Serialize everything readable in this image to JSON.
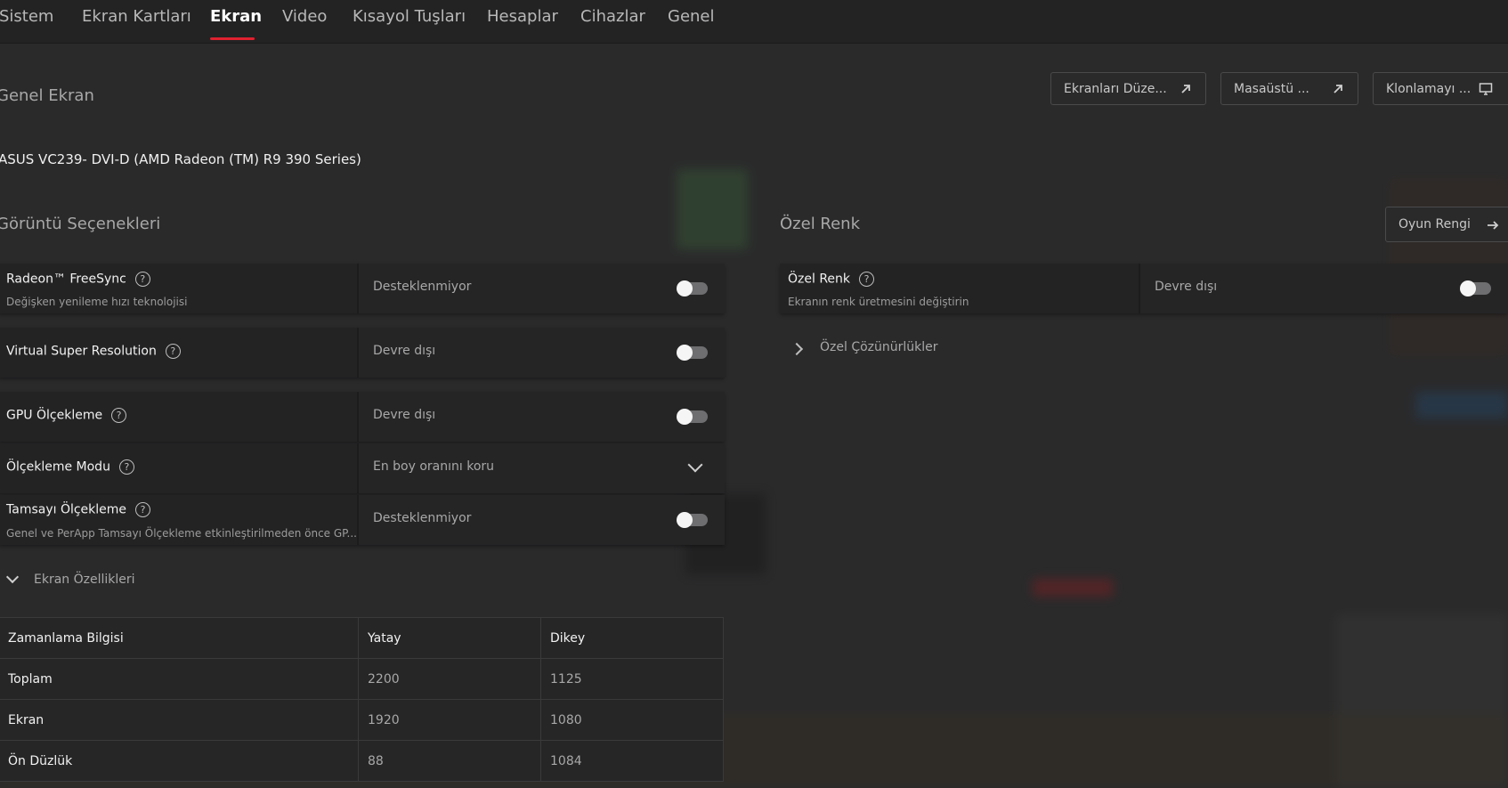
{
  "nav": {
    "tabs": [
      "Sistem",
      "Ekran Kartları",
      "Ekran",
      "Video",
      "Kısayol Tuşları",
      "Hesaplar",
      "Cihazlar",
      "Genel"
    ],
    "active_tab": "Ekran"
  },
  "general": {
    "title": "Genel Ekran",
    "device": "ASUS VC239- DVI-D (AMD Radeon (TM) R9 390 Series)"
  },
  "header_buttons": {
    "arrange_label": "Ekranları Düze...",
    "desktop_label": "Masaüstü ...",
    "clone_label": "Klonlamayı ..."
  },
  "display_options": {
    "title": "Görüntü Seçenekleri",
    "freesync": {
      "title": "Radeon™ FreeSync",
      "subtitle": "Değişken yenileme hızı teknolojisi",
      "value": "Desteklenmiyor",
      "enabled": false
    },
    "vsr": {
      "title": "Virtual Super Resolution",
      "value": "Devre dışı",
      "enabled": false
    },
    "gpu_scaling": {
      "title": "GPU Ölçekleme",
      "value": "Devre dışı",
      "enabled": false
    },
    "scaling_mode": {
      "title": "Ölçekleme Modu",
      "value": "En boy oranını koru"
    },
    "integer_scaling": {
      "title": "Tamsayı Ölçekleme",
      "subtitle": "Genel ve PerApp Tamsayı Ölçekleme etkinleştirilmeden önce GP...",
      "value": "Desteklenmiyor",
      "enabled": false
    }
  },
  "custom_color": {
    "title": "Özel Renk",
    "game_color_button": "Oyun Rengi",
    "row": {
      "title": "Özel Renk",
      "subtitle": "Ekranın renk üretmesini değiştirin",
      "value": "Devre dışı",
      "enabled": false
    },
    "custom_resolutions": "Özel Çözünürlükler"
  },
  "display_specs": {
    "label": "Ekran Özellikleri",
    "headers": [
      "Zamanlama Bilgisi",
      "Yatay",
      "Dikey"
    ],
    "rows": [
      [
        "Toplam",
        "2200",
        "1125"
      ],
      [
        "Ekran",
        "1920",
        "1080"
      ],
      [
        "Ön Düzlük",
        "88",
        "1084"
      ]
    ]
  },
  "colors": {
    "accent": "#e0212f",
    "background": "#2a2a2b",
    "row": "#232324"
  }
}
